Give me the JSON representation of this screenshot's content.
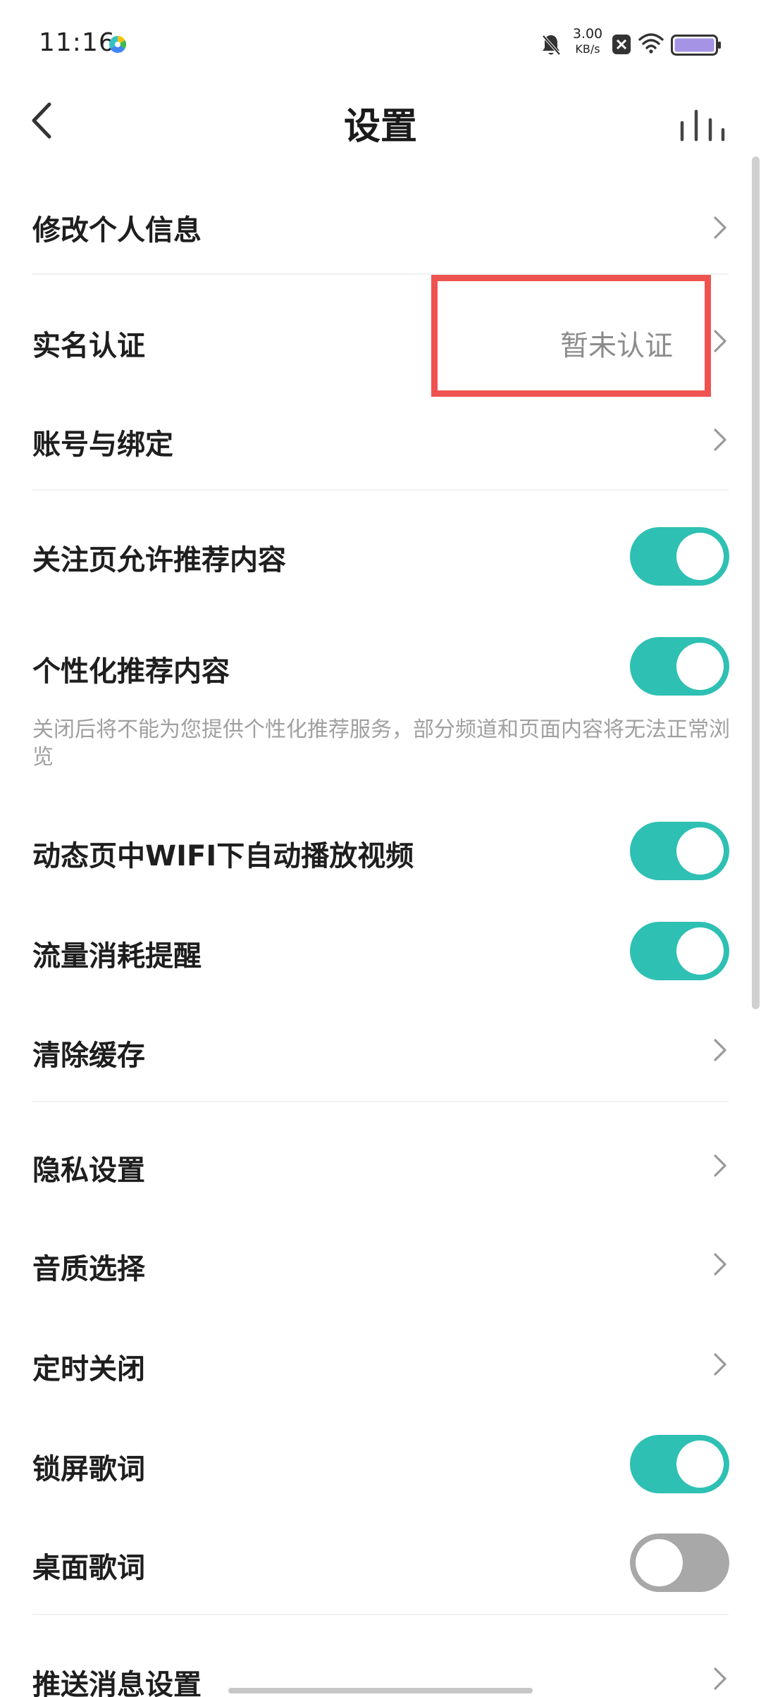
{
  "status_bar": {
    "time": "11:16",
    "net_speed_value": "3.00",
    "net_speed_unit": "KB/s",
    "icons": [
      "bell-off-icon",
      "close-box-icon",
      "wifi-icon",
      "battery-icon"
    ]
  },
  "header": {
    "title": "设置",
    "back_icon": "chevron-left-icon",
    "right_icon": "equalizer-icon"
  },
  "settings": {
    "edit_profile": "修改个人信息",
    "real_name": {
      "label": "实名认证",
      "value": "暂未认证"
    },
    "account_binding": "账号与绑定",
    "follow_recommend": {
      "label": "关注页允许推荐内容",
      "on": true
    },
    "personal_recommend": {
      "label": "个性化推荐内容",
      "on": true,
      "description": "关闭后将不能为您提供个性化推荐服务，部分频道和页面内容将无法正常浏览"
    },
    "wifi_autoplay": {
      "label": "动态页中WIFI下自动播放视频",
      "on": true
    },
    "data_reminder": {
      "label": "流量消耗提醒",
      "on": true
    },
    "clear_cache": "清除缓存",
    "privacy": "隐私设置",
    "audio_quality": "音质选择",
    "timer_off": "定时关闭",
    "lock_lyrics": {
      "label": "锁屏歌词",
      "on": true
    },
    "desktop_lyrics": {
      "label": "桌面歌词",
      "on": false
    },
    "push_settings": "推送消息设置"
  },
  "colors": {
    "accent": "#2ec0b3",
    "toggle_off": "#a8a8a8",
    "highlight": "#ef5350"
  }
}
